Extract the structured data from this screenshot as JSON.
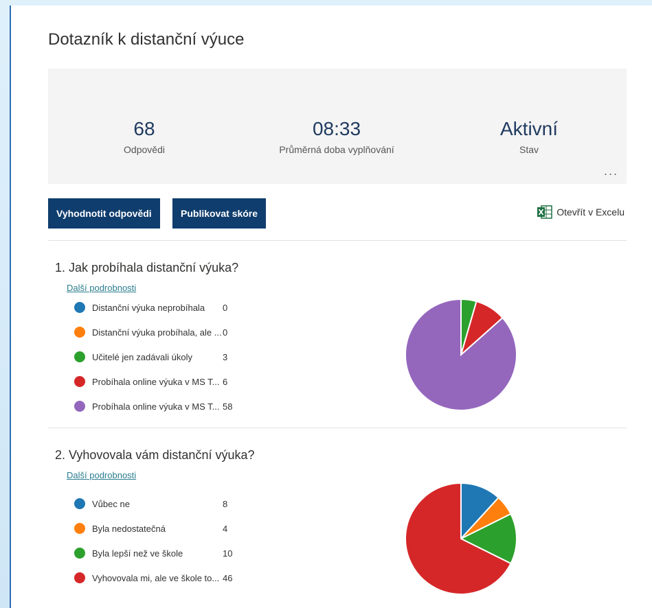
{
  "title": "Dotazník k distanční výuce",
  "summary": {
    "responses": {
      "value": "68",
      "label": "Odpovědi"
    },
    "avg_time": {
      "value": "08:33",
      "label": "Průměrná doba vyplňování"
    },
    "status": {
      "value": "Aktivní",
      "label": "Stav"
    },
    "more": "..."
  },
  "toolbar": {
    "review_label": "Vyhodnotit odpovědi",
    "publish_label": "Publikovat skóre",
    "excel_label": "Otevřít v Excelu"
  },
  "questions": [
    {
      "title": "1. Jak probíhala distanční výuka?",
      "details": "Další podrobnosti",
      "chart_data": {
        "type": "pie",
        "categories": [
          "Distanční výuka neprobíhala",
          "Distanční výuka probíhala, ale ...",
          "Učitelé jen zadávali úkoly",
          "Probíhala online výuka v MS T...",
          "Probíhala online výuka v MS T..."
        ],
        "values": [
          0,
          0,
          3,
          6,
          58
        ],
        "colors": [
          "#1f77b4",
          "#ff7f0e",
          "#2ca02c",
          "#d62728",
          "#9467bd"
        ]
      }
    },
    {
      "title": "2. Vyhovovala vám distanční výuka?",
      "details": "Další podrobnosti",
      "chart_data": {
        "type": "pie",
        "categories": [
          "Vůbec ne",
          "Byla nedostatečná",
          "Byla lepší než ve škole",
          "Vyhovovala mi, ale ve škole to..."
        ],
        "values": [
          8,
          4,
          10,
          46
        ],
        "colors": [
          "#1f77b4",
          "#ff7f0e",
          "#2ca02c",
          "#d62728"
        ]
      }
    }
  ]
}
